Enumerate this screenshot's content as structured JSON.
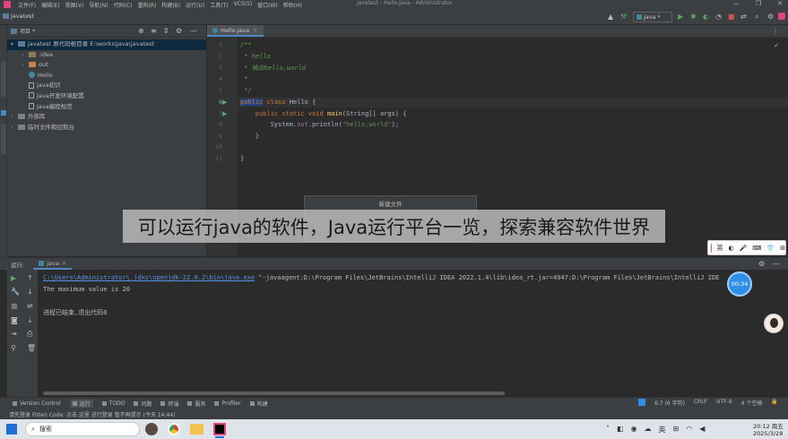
{
  "window": {
    "title": "javatest - Hello.java - Administrator"
  },
  "menu": [
    "文件(F)",
    "编辑(E)",
    "视图(V)",
    "导航(N)",
    "代码(C)",
    "重构(R)",
    "构建(B)",
    "运行(U)",
    "工具(T)",
    "VCS(S)",
    "窗口(W)",
    "帮助(H)"
  ],
  "navbar": {
    "breadcrumb": "javatest",
    "run_config": "java"
  },
  "project": {
    "header": "项目",
    "tree": [
      {
        "label": "javatest 原代码根目录  E:\\works\\java\\javatest",
        "kind": "folder-blue",
        "indent": 0,
        "selected": true
      },
      {
        "label": ".idea",
        "kind": "folder",
        "indent": 1
      },
      {
        "label": "out",
        "kind": "folder-orange",
        "indent": 1
      },
      {
        "label": "Hello",
        "kind": "class",
        "indent": 1
      },
      {
        "label": "java初识",
        "kind": "file",
        "indent": 1
      },
      {
        "label": "Java开发环境配置",
        "kind": "file",
        "indent": 1
      },
      {
        "label": "java编程规范",
        "kind": "file",
        "indent": 1
      },
      {
        "label": "外部库",
        "kind": "lib",
        "indent": 0
      },
      {
        "label": "临时文件和控制台",
        "kind": "lib",
        "indent": 0
      }
    ]
  },
  "editor": {
    "tab": "Hello.java",
    "lines": [
      "1",
      "2",
      "3",
      "4",
      "5",
      "6",
      "7",
      "8",
      "9",
      "10",
      "11"
    ],
    "code": {
      "l1": "/**",
      "l2": " * hello",
      "l3": " * 输出hello,world",
      "l4": " *",
      "l5": " */",
      "l6a": "public",
      "l6b": " class ",
      "l6c": "Hello {",
      "l7a": "    public static void ",
      "l7b": "main",
      "l7c": "(String[] args) {",
      "l8a": "        System.",
      "l8b": "out",
      "l8c": ".println(",
      "l8d": "\"hello,world\"",
      "l8e": ");",
      "l9": "    }",
      "l11": "}"
    }
  },
  "popup": {
    "title": "新建文件"
  },
  "run": {
    "label": "运行:",
    "tab": "java",
    "cmd_path": "C:\\Users\\Administrator\\.jdks\\openjdk-22.0.2\\bin\\java.exe",
    "cmd_rest": " \"-javaagent:D:\\Program Files\\JetBrains\\IntelliJ IDEA 2022.1.4\\lib\\idea_rt.jar=4947:D:\\Program Files\\JetBrains\\IntelliJ IDE",
    "output1": "The maximum value is 20",
    "output2": "进程已结束,退出代码0"
  },
  "timer": "00:34",
  "statusbar": {
    "items": [
      "Version Control",
      "运行",
      "TODO",
      "问题",
      "终端",
      "服务",
      "Profiler",
      "构建"
    ],
    "right": [
      "6:7 (6 字符)",
      "CRLF",
      "UTF-8",
      "4 个空格"
    ]
  },
  "infobar": {
    "text": "请先登录 Fitten Code: 点击 这里 进行登录   暂不再提示 (今天 14:44)"
  },
  "ime": {
    "label": "英"
  },
  "overlay": {
    "caption": "可以运行java的软件，Java运行平台一览，探索兼容软件世界"
  },
  "taskbar": {
    "search": "搜索",
    "time": "20:12 周五",
    "date": "2025/3/28"
  }
}
